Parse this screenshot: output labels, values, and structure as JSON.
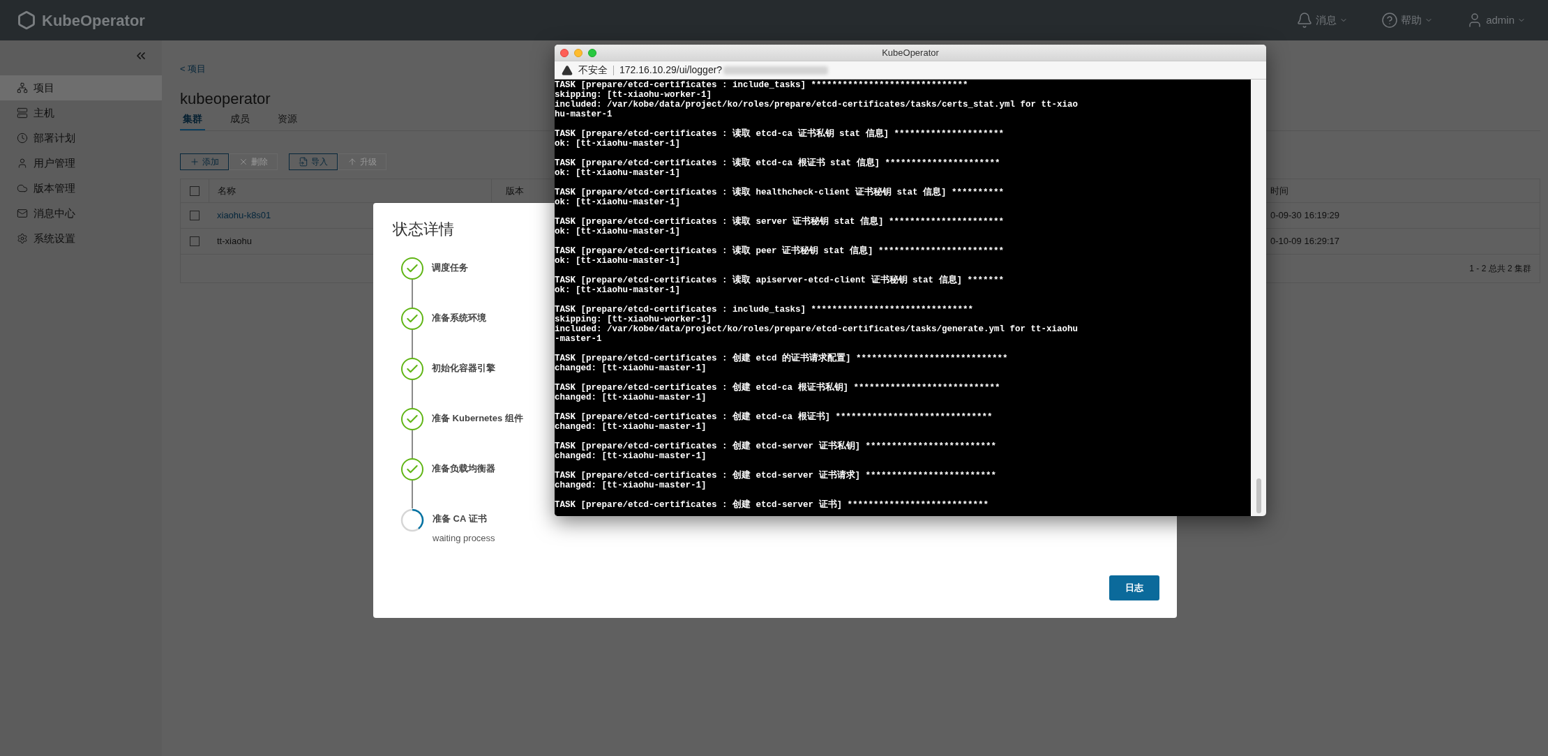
{
  "header": {
    "logo": "KubeOperator",
    "menus": [
      {
        "label": "消息"
      },
      {
        "label": "帮助"
      },
      {
        "label": "admin"
      }
    ]
  },
  "sidebar": {
    "items": [
      {
        "label": "项目",
        "selected": true
      },
      {
        "label": "主机",
        "selected": false
      },
      {
        "label": "部署计划",
        "selected": false
      },
      {
        "label": "用户管理",
        "selected": false
      },
      {
        "label": "版本管理",
        "selected": false
      },
      {
        "label": "消息中心",
        "selected": false
      },
      {
        "label": "系统设置",
        "selected": false
      }
    ]
  },
  "breadcrumb": "< 项目",
  "project": {
    "title": "kubeoperator",
    "tabs": [
      {
        "label": "集群",
        "selected": true
      },
      {
        "label": "成员",
        "selected": false
      },
      {
        "label": "资源",
        "selected": false
      }
    ]
  },
  "toolbar": [
    {
      "label": "添加",
      "disabled": false
    },
    {
      "label": "删除",
      "disabled": true
    },
    {
      "label": "导入",
      "disabled": false
    },
    {
      "label": "升级",
      "disabled": true
    }
  ],
  "table": {
    "columns": [
      "名称",
      "版本",
      "时间"
    ],
    "all_checked": false,
    "rows": [
      {
        "name": "xiaohu-k8s01",
        "checked": false,
        "linked": true,
        "time": "0-09-30 16:19:29"
      },
      {
        "name": "tt-xiaohu",
        "checked": false,
        "linked": false,
        "time": "0-10-09 16:29:17"
      }
    ],
    "footer": "1 - 2 总共 2 集群"
  },
  "modal": {
    "title": "状态详情",
    "steps": [
      {
        "label": "调度任务",
        "done": true
      },
      {
        "label": "准备系统环境",
        "done": true
      },
      {
        "label": "初始化容器引擎",
        "done": true
      },
      {
        "label": "准备 Kubernetes 组件",
        "done": true
      },
      {
        "label": "准备负载均衡器",
        "done": true
      },
      {
        "label": "准备 CA 证书",
        "done": false,
        "detail": "waiting process"
      }
    ],
    "button": "日志"
  },
  "browser": {
    "title": "KubeOperator",
    "security": "不安全",
    "url": "172.16.10.29/ui/logger?",
    "log": [
      [
        "TASK [prepare/etcd-certificates : include_tasks] ******************************",
        "skipping: [tt-xiaohu-worker-1]",
        "included: /var/kobe/data/project/ko/roles/prepare/etcd-certificates/tasks/certs_stat.yml for tt-xiao",
        "hu-master-1"
      ],
      [
        "TASK [prepare/etcd-certificates : 读取 etcd-ca 证书私钥 stat 信息] *********************",
        "ok: [tt-xiaohu-master-1]"
      ],
      [
        "TASK [prepare/etcd-certificates : 读取 etcd-ca 根证书 stat 信息] **********************",
        "ok: [tt-xiaohu-master-1]"
      ],
      [
        "TASK [prepare/etcd-certificates : 读取 healthcheck-client 证书秘钥 stat 信息] **********",
        "ok: [tt-xiaohu-master-1]"
      ],
      [
        "TASK [prepare/etcd-certificates : 读取 server 证书秘钥 stat 信息] **********************",
        "ok: [tt-xiaohu-master-1]"
      ],
      [
        "TASK [prepare/etcd-certificates : 读取 peer 证书秘钥 stat 信息] ************************",
        "ok: [tt-xiaohu-master-1]"
      ],
      [
        "TASK [prepare/etcd-certificates : 读取 apiserver-etcd-client 证书秘钥 stat 信息] *******",
        "ok: [tt-xiaohu-master-1]"
      ],
      [
        "TASK [prepare/etcd-certificates : include_tasks] *******************************",
        "skipping: [tt-xiaohu-worker-1]",
        "included: /var/kobe/data/project/ko/roles/prepare/etcd-certificates/tasks/generate.yml for tt-xiaohu",
        "-master-1"
      ],
      [
        "TASK [prepare/etcd-certificates : 创建 etcd 的证书请求配置] *****************************",
        "changed: [tt-xiaohu-master-1]"
      ],
      [
        "TASK [prepare/etcd-certificates : 创建 etcd-ca 根证书私钥] ****************************",
        "changed: [tt-xiaohu-master-1]"
      ],
      [
        "TASK [prepare/etcd-certificates : 创建 etcd-ca 根证书] ******************************",
        "changed: [tt-xiaohu-master-1]"
      ],
      [
        "TASK [prepare/etcd-certificates : 创建 etcd-server 证书私钥] *************************",
        "changed: [tt-xiaohu-master-1]"
      ],
      [
        "TASK [prepare/etcd-certificates : 创建 etcd-server 证书请求] *************************",
        "changed: [tt-xiaohu-master-1]"
      ],
      [
        "TASK [prepare/etcd-certificates : 创建 etcd-server 证书] ***************************"
      ]
    ]
  }
}
